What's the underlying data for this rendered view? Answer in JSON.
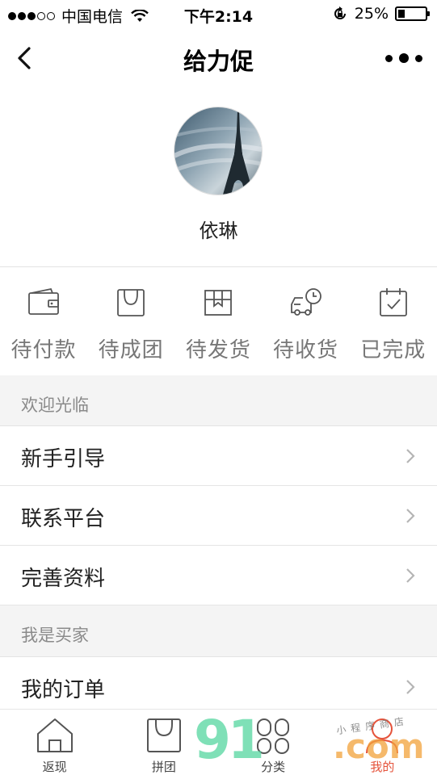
{
  "status_bar": {
    "carrier": "中国电信",
    "time": "下午2:14",
    "battery": "25%",
    "battery_level": 0.25
  },
  "nav": {
    "title": "给力促"
  },
  "profile": {
    "username": "依琳"
  },
  "orders": [
    {
      "label": "待付款",
      "icon": "wallet-icon"
    },
    {
      "label": "待成团",
      "icon": "shopping-bag-icon"
    },
    {
      "label": "待发货",
      "icon": "package-icon"
    },
    {
      "label": "待收货",
      "icon": "delivery-truck-icon"
    },
    {
      "label": "已完成",
      "icon": "calendar-check-icon"
    }
  ],
  "sections": [
    {
      "header": "欢迎光临",
      "items": [
        "新手引导",
        "联系平台",
        "完善资料"
      ]
    },
    {
      "header": "我是买家",
      "items": [
        "我的订单"
      ]
    }
  ],
  "tab_bar": {
    "tabs": [
      {
        "label": "返现",
        "icon": "home-icon"
      },
      {
        "label": "拼团",
        "icon": "shopping-bag-icon"
      },
      {
        "label": "分类",
        "icon": "grid-icon"
      },
      {
        "label": "我的",
        "icon": "user-icon"
      }
    ],
    "active_color": "#e5533b"
  },
  "watermark": {
    "brand_left": "91",
    "brand_right": ".com",
    "tagline": "小程序商店"
  }
}
